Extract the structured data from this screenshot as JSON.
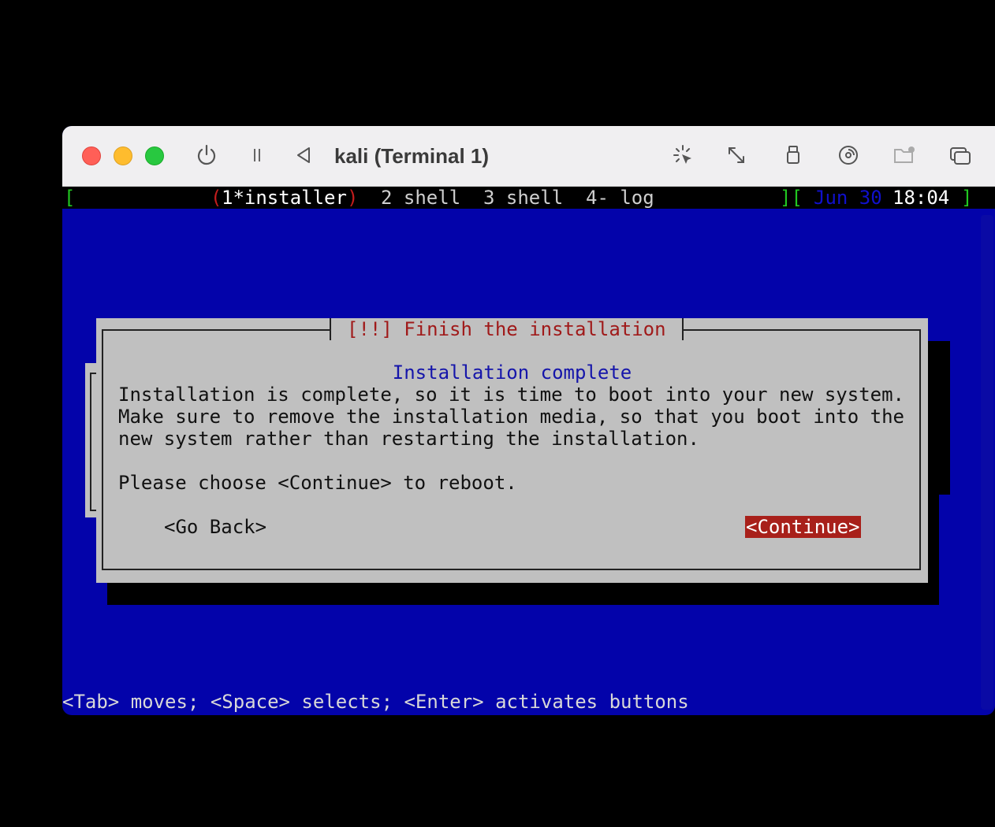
{
  "window": {
    "title": "kali (Terminal 1)"
  },
  "toolbar": {
    "icons": [
      "power-icon",
      "pause-icon",
      "back-triangle-icon",
      "capture-cursor-icon",
      "resize-arrows-icon",
      "usb-icon",
      "disc-icon",
      "shared-folder-icon",
      "windows-icon"
    ]
  },
  "statusbar": {
    "left_bracket": "[",
    "tab1_open": "(",
    "tab1_label": "1*installer",
    "tab1_close": ")",
    "tab2_label": "2 shell",
    "tab3_label": "3 shell",
    "tab4_label": "4- log",
    "right_bracket": "][",
    "date": "Jun 30",
    "time": "18:04",
    "end_bracket": "]"
  },
  "dialog": {
    "title": "[!!] Finish the installation",
    "heading": "Installation complete",
    "body_lines": [
      "Installation is complete, so it is time to boot into your new system.",
      "Make sure to remove the installation media, so that you boot into the",
      "new system rather than restarting the installation.",
      "",
      "Please choose <Continue> to reboot."
    ],
    "go_back_label": "<Go Back>",
    "continue_label": "<Continue>"
  },
  "help_line": "<Tab> moves; <Space> selects; <Enter> activates buttons",
  "colors": {
    "terminal_bg": "#0303aa",
    "dialog_bg": "#c0c0c0",
    "accent_red": "#a8201a"
  }
}
